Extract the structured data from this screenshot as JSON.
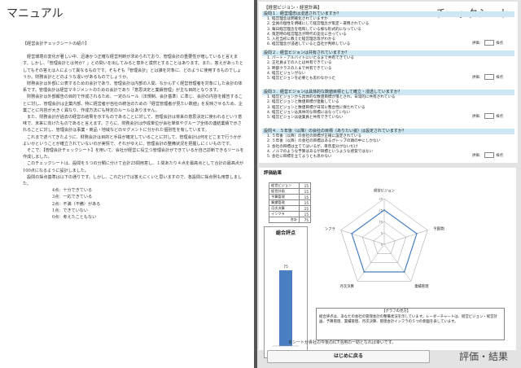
{
  "manual": {
    "title": "マニュアル",
    "heading": "【経営会計チェックシートの紹介】",
    "paragraphs": [
      "経営環境の変化が著しい中、迅速かつ正確な経営判断が求められており、管理会計の重要性が増していると言えます。しかし、「管理会計とは何か？」との問いを出してみると意外と漠然とすることはあります。また、答えがあったとしてもその答えは人によって異なるものです。そもそも「管理会計」とは誰を対象に、どのように使用するものでしょうか。財務会計とどのような違いがあるものでしょうか。",
      "財務会計は外部に公表するための会計であり、管理会計は内部の人間、なかんずく経営管理者を対象にした会計の体系です。管理会計は経営マネジメントのための会計であり「意思決定と業績管理」が主な目的となります。",
      "財務会計は外部報告の目的で作成されるため、一定のルール（法規制、会計基準）に準じ、会計の内容を報告することに対し、管理会計は企業内部、特に経営者が自社の統治のための「経営管理者が見たい数値」を反映させるため、企業ごとに内容が大きく異なり、作成方法にも特定のルールはありません。",
      "また、財務会計が過去の経営の結果を示すものであることに対して、管理会計は将来の意思決定に使われるという意味で、未来に向けたものであると言えます。さらに、財務会計は作成単位が会社単体やグループ全体の連結業績で示されることに対し、管理会計は事業・商品・地域などのセグメントに分かれた個別性を有しています。",
      "これまで述べてきたように、財務会計は目的と手段が確定していることに対して、管理会計は何をどこまで行うかがよいかということが確立されていないのが実情で、それがゆえに、管理会計の整備状況を把握しにくいものです。",
      "そこで、【管理会計チェックシート】を用いて、会社が経営に役立つ管理会計ができているか自己診断できるツールを作成しました。",
      "このチェックシートは、設問を５つの分類に分けて合計25問用意し、１問あたり４点を最高点として合計の最高点が100点になるように設計しました。",
      "設問の採点基準は以下の通りです。しかし、これだけでは答えにくいと思いますので、各設問に採点例も用意しました。"
    ],
    "scale": [
      "4点：十分できている",
      "3点：一応できている",
      "2点：不満（不備）がある",
      "1点：できていない",
      "0点：考えたこともない"
    ]
  },
  "sheet": {
    "header": "【経営ビジョン・経営計画】",
    "title": "チェックシート",
    "score_label": "評価：",
    "score_suffix": "採点",
    "questions": [
      {
        "label": "設問１．経営理念は浸透されていますか？",
        "items": [
          "経営理念は明確化されていますか",
          "全員の個性を明確にして経営理念が策定・運用されている",
          "毎日経営理念を唱和している様な形式的になっている",
          "策定時の経営理念が時代の変化に合っている",
          "入社当初に教えた経営理念等がわかる",
          "経営理念が浸透していると自社が判断している"
        ]
      },
      {
        "label": "設問２．経営ビジョンは共有されていますか？",
        "items": [
          "パート・アルバイトにいたるまで共有できている",
          "正社員までの人とは共有できている",
          "幹部クラスの人まで共有できている",
          "経営ビジョンがない",
          "経営ビジョンを必要とも思わなかった"
        ]
      },
      {
        "label": "設問３．経営ビジョンは具体的な数値目標として確立・浸透していますか？",
        "items": [
          "経営ビジョンから具体的な数値目標が落とされ、日常的に共有されている",
          "経営ビジョンと数値目標が連動している",
          "経営ビジョンと数値目標が日常に整合性に保たれている",
          "経営ビジョンは具体的な目標にはなっていない",
          "経営ビジョンは従業員と共有できていない"
        ]
      },
      {
        "label": "設問４．５年後（以降）の会社の目標（ありたい姿）は設定されていますか？",
        "items": [
          "５年後（以降）の会社の目標が正確に設定されている",
          "５年後（以降）の会社の目標はあるがトップの頭の中にしかない",
          "会社の目標は立ててはいるが、単年度分がないだけ",
          "ノルマのような予算はあるが目標というような感覚ではない",
          "会社に目標を立てようとも思わない"
        ]
      }
    ]
  },
  "evaluation": {
    "title": "評価結果",
    "table": [
      {
        "label": "経営ビジョン",
        "value": "15"
      },
      {
        "label": "経営計画",
        "value": "15"
      },
      {
        "label": "予算管理",
        "value": "15"
      },
      {
        "label": "業績管理",
        "value": "15"
      },
      {
        "label": "月次決算",
        "value": "15"
      },
      {
        "label": "インフラ",
        "value": "15"
      },
      {
        "label": "合計",
        "value": "75"
      }
    ],
    "total_title": "総合評点",
    "total_value": 75,
    "total_max": 100,
    "radar": {
      "axes": [
        "経営ビジョン",
        "予算管理",
        "業績管理",
        "月次決算",
        "インフラ"
      ],
      "values": [
        15,
        15,
        15,
        15,
        15
      ],
      "max": 20,
      "tick_labels": [
        "20",
        "15",
        "10",
        "5",
        "0"
      ]
    },
    "comment_title": "【グラフの見方】",
    "comment_body": "総合評点は、あなたの会社の管理会計の整備状況を示しています。レーダーチャートは、経営ビジョン・経営計画、予算管理、業績管理、月次決算、管理会計インフラの５つの側面を表しています。",
    "bottom_message": "本シートが貴社の今後のICT活用の一助となれば幸いです。",
    "back_button": "はじめに戻る",
    "result_label": "評価・結果"
  },
  "colors": {
    "question_bar": "#cde8f3",
    "accent": "#4a7fc1",
    "divider": "#555555"
  }
}
